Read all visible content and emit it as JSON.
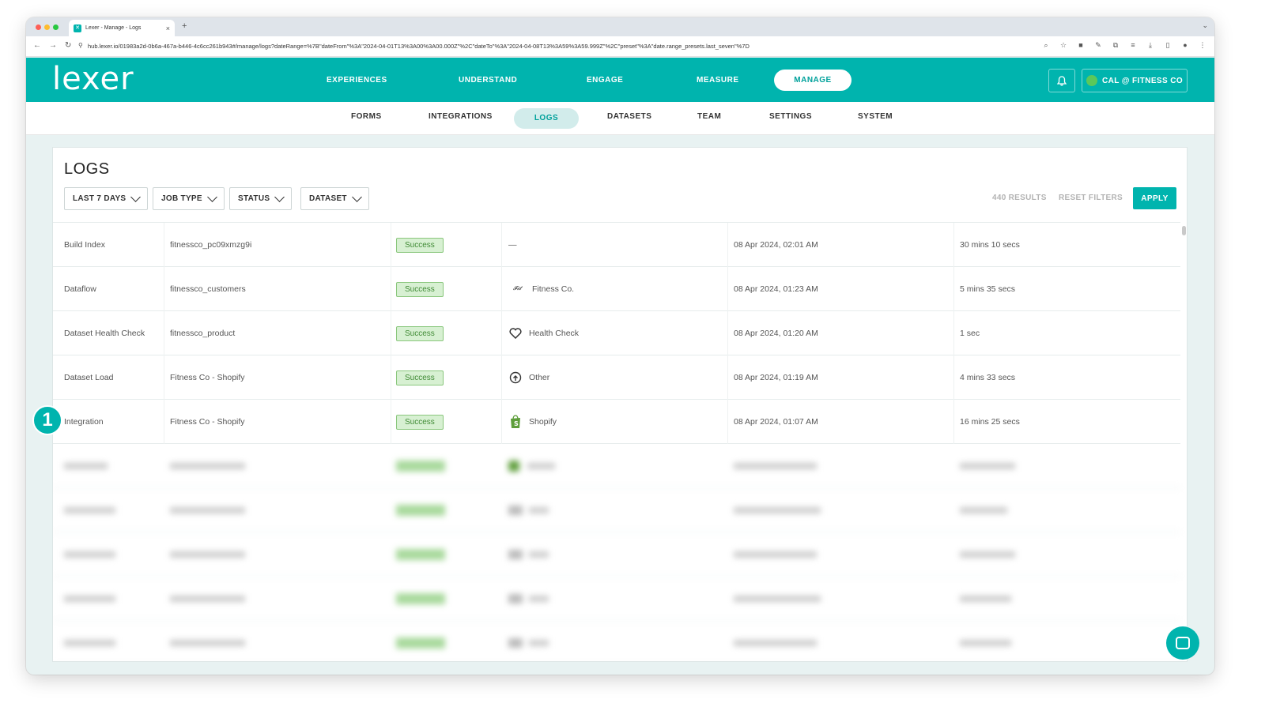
{
  "browser": {
    "tab_title": "Lexer - Manage - Logs",
    "url": "hub.lexer.io/01983a2d-0b6a-467a-b446-4c6cc261b943#/manage/logs?dateRange=%7B\"dateFrom\"%3A\"2024-04-01T13%3A00%3A00.000Z\"%2C\"dateTo\"%3A\"2024-04-08T13%3A59%3A59.999Z\"%2C\"preset\"%3A\"date.range_presets.last_seven\"%7D"
  },
  "header": {
    "logo": "lexer",
    "nav": [
      "EXPERIENCES",
      "UNDERSTAND",
      "ENGAGE",
      "MEASURE",
      "MANAGE"
    ],
    "active_nav": "MANAGE",
    "account": "CAL @ FITNESS CO"
  },
  "subnav": {
    "items": [
      "FORMS",
      "INTEGRATIONS",
      "LOGS",
      "DATASETS",
      "TEAM",
      "SETTINGS",
      "SYSTEM"
    ],
    "active": "LOGS"
  },
  "page": {
    "title": "LOGS",
    "filters": [
      "LAST 7 DAYS",
      "JOB TYPE",
      "STATUS",
      "DATASET"
    ],
    "results": "440 RESULTS",
    "reset": "RESET FILTERS",
    "apply": "APPLY"
  },
  "rows": [
    {
      "type": "Build Index",
      "name": "fitnessco_pc09xmzg9i",
      "status": "Success",
      "source": "—",
      "source_icon": "dash",
      "date": "08 Apr 2024, 02:01 AM",
      "duration": "30 mins 10 secs"
    },
    {
      "type": "Dataflow",
      "name": "fitnessco_customers",
      "status": "Success",
      "source": "Fitness Co.",
      "source_icon": "fitness-logo",
      "date": "08 Apr 2024, 01:23 AM",
      "duration": "5 mins 35 secs"
    },
    {
      "type": "Dataset Health Check",
      "name": "fitnessco_product",
      "status": "Success",
      "source": "Health Check",
      "source_icon": "heart",
      "date": "08 Apr 2024, 01:20 AM",
      "duration": "1 sec"
    },
    {
      "type": "Dataset Load",
      "name": "Fitness Co - Shopify",
      "status": "Success",
      "source": "Other",
      "source_icon": "upload-cloud",
      "date": "08 Apr 2024, 01:19 AM",
      "duration": "4 mins 33 secs"
    },
    {
      "type": "Integration",
      "name": "Fitness Co - Shopify",
      "status": "Success",
      "source": "Shopify",
      "source_icon": "shopify-bag",
      "date": "08 Apr 2024, 01:07 AM",
      "duration": "16 mins 25 secs"
    }
  ],
  "step_marker": "1",
  "colors": {
    "brand": "#00b4ae",
    "success_bg": "#d7f0d2",
    "success_border": "#8ac77d"
  }
}
